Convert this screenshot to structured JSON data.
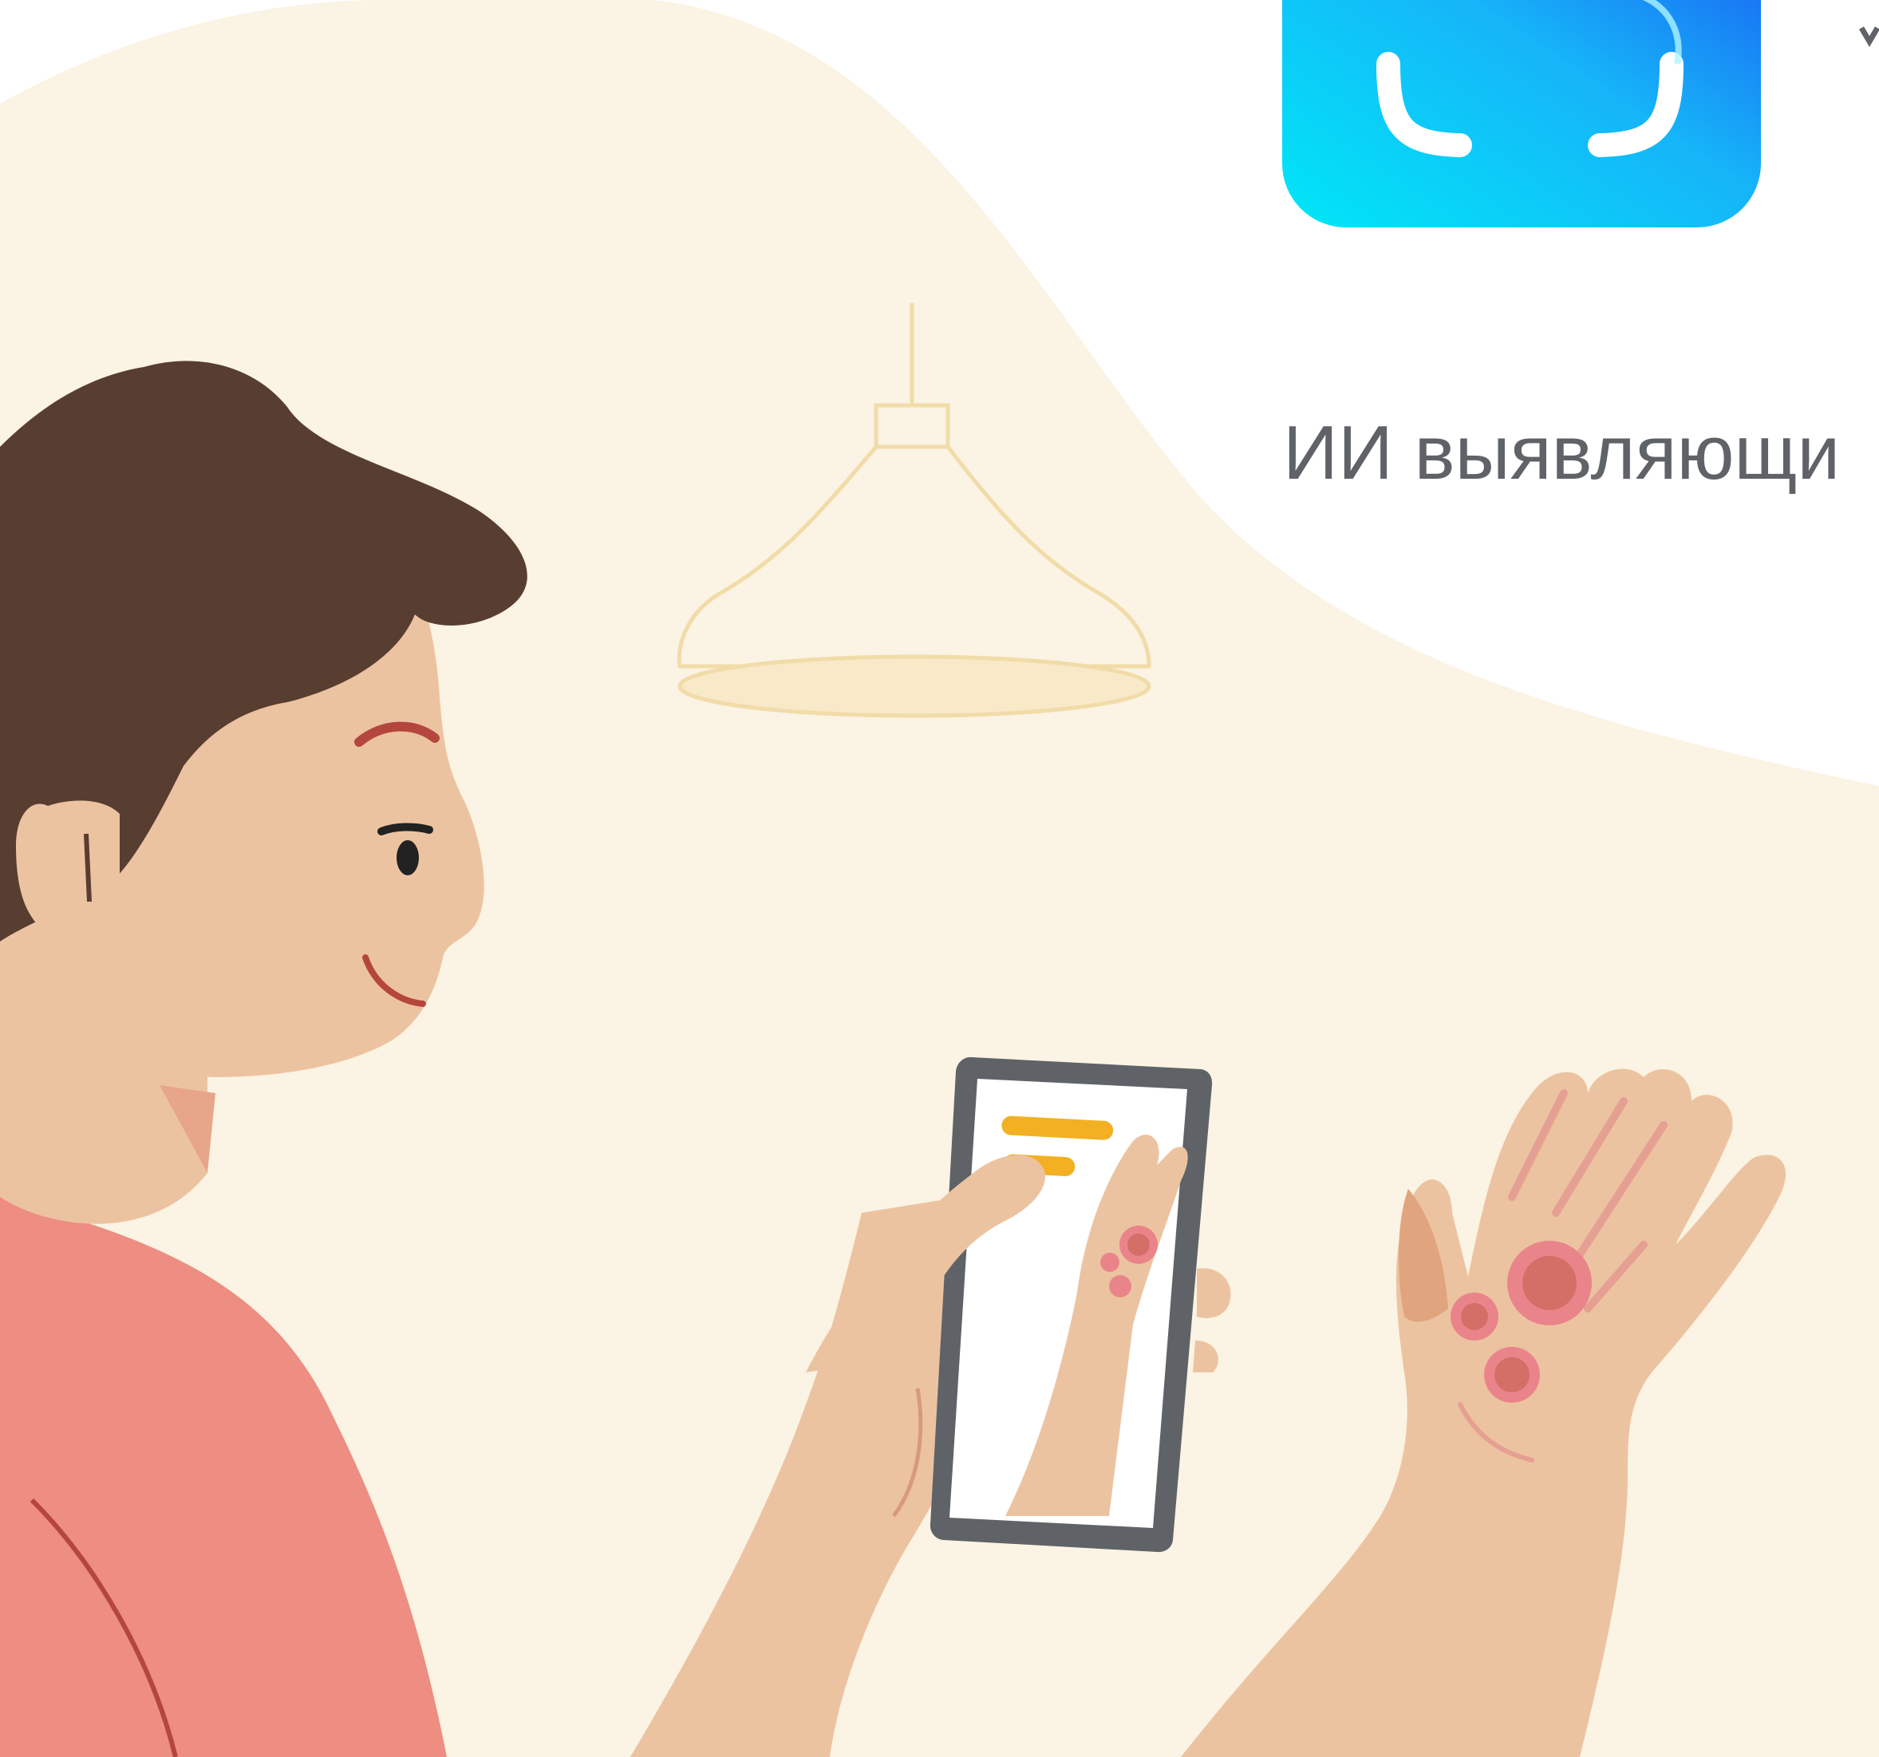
{
  "headline": {
    "text": "ИИ выявляющи"
  },
  "illustration": {
    "subject": "person-photographing-hand-rash-icon",
    "colors": {
      "background_blob": "#fbf3e3",
      "hair": "#583d31",
      "skin": "#ecc3a1",
      "skin_shadow": "#e7a58a",
      "shirt": "#ee8d81",
      "rash_outer": "#e9858a",
      "rash_inner": "#d46f67",
      "phone_frame": "#5f6368",
      "phone_screen": "#ffffff",
      "screen_bars": "#f2b022",
      "app_icon_cyan": "#00e5f5",
      "app_icon_blue": "#1c6cf4"
    }
  }
}
